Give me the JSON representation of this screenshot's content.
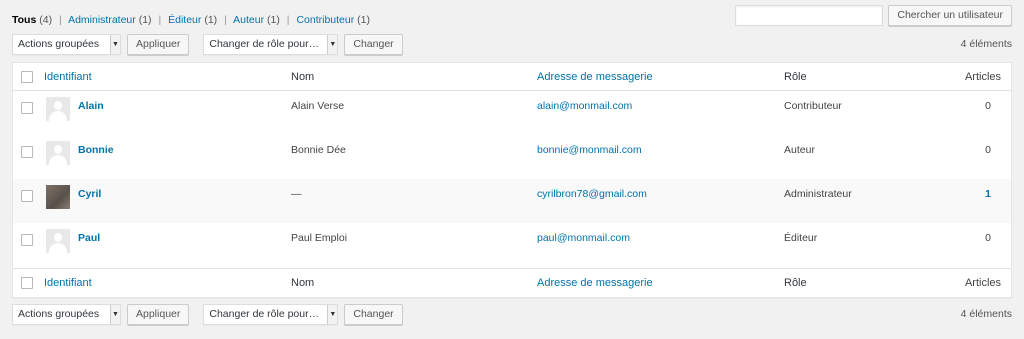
{
  "filters": [
    {
      "label": "Tous",
      "count": "(4)",
      "current": true
    },
    {
      "label": "Administrateur",
      "count": "(1)"
    },
    {
      "label": "Éditeur",
      "count": "(1)"
    },
    {
      "label": "Auteur",
      "count": "(1)"
    },
    {
      "label": "Contributeur",
      "count": "(1)"
    }
  ],
  "search": {
    "value": "",
    "button_label": "Chercher un utilisateur"
  },
  "bulk": {
    "selected": "Actions groupées",
    "apply_label": "Appliquer"
  },
  "role_change": {
    "selected": "Changer de rôle pour…",
    "button_label": "Changer"
  },
  "item_count": "4 éléments",
  "columns": {
    "username": "Identifiant",
    "name": "Nom",
    "email": "Adresse de messagerie",
    "role": "Rôle",
    "posts": "Articles"
  },
  "users": [
    {
      "username": "Alain",
      "name": "Alain Verse",
      "email": "alain@monmail.com",
      "role": "Contributeur",
      "posts": "0",
      "avatar": "default-avatar-icon"
    },
    {
      "username": "Bonnie",
      "name": "Bonnie Dée",
      "email": "bonnie@monmail.com",
      "role": "Auteur",
      "posts": "0",
      "avatar": "default-avatar-icon"
    },
    {
      "username": "Cyril",
      "name": "—",
      "email": "cyrilbron78@gmail.com",
      "role": "Administrateur",
      "posts": "1",
      "avatar": "photo-avatar"
    },
    {
      "username": "Paul",
      "name": "Paul Emploi",
      "email": "paul@monmail.com",
      "role": "Éditeur",
      "posts": "0",
      "avatar": "default-avatar-icon"
    }
  ],
  "colors": {
    "link": "#0073aa",
    "background": "#f1f1f1",
    "row_alt": "#f9f9f9"
  }
}
